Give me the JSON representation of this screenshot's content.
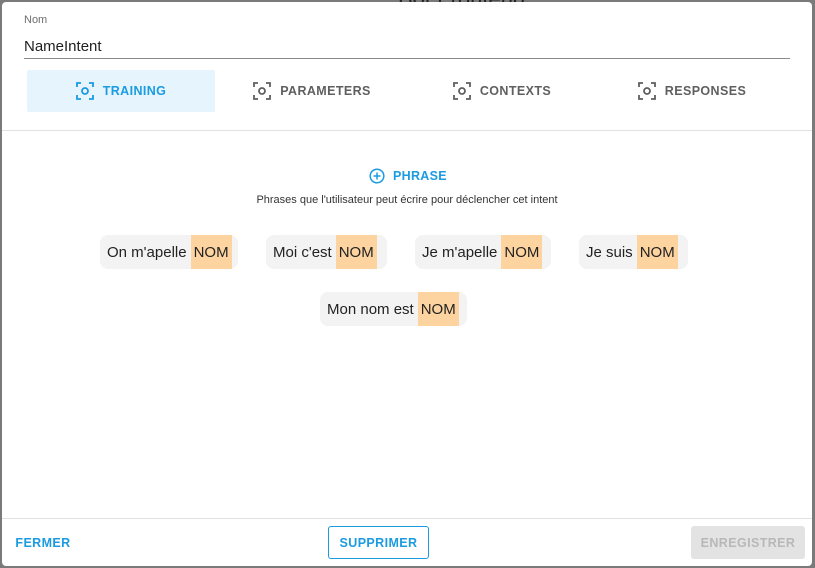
{
  "backdrop": {
    "title": "Bot Frontend"
  },
  "name_field": {
    "label": "Nom",
    "value": "NameIntent"
  },
  "tabs": [
    {
      "label": "TRAINING",
      "icon": "focus-frame-icon",
      "active": true
    },
    {
      "label": "PARAMETERS",
      "icon": "focus-frame-icon",
      "active": false
    },
    {
      "label": "CONTEXTS",
      "icon": "focus-frame-icon",
      "active": false
    },
    {
      "label": "RESPONSES",
      "icon": "focus-frame-icon",
      "active": false
    }
  ],
  "training": {
    "add_phrase_label": "PHRASE",
    "add_phrase_icon": "plus-circle-icon",
    "helper_text": "Phrases que l'utilisateur peut écrire pour déclencher cet intent",
    "phrases": [
      {
        "text": "On m'apelle",
        "entity": "NOM"
      },
      {
        "text": "Moi c'est",
        "entity": "NOM"
      },
      {
        "text": "Je m'apelle",
        "entity": "NOM"
      },
      {
        "text": "Je suis",
        "entity": "NOM"
      },
      {
        "text": "Mon nom est",
        "entity": "NOM"
      }
    ]
  },
  "footer": {
    "close_label": "FERMER",
    "delete_label": "SUPPRIMER",
    "save_label": "ENREGISTRER"
  },
  "colors": {
    "accent": "#1b9be0",
    "active_tab_bg": "#e6f4fd",
    "entity_highlight": "#fdd4a0",
    "chip_bg": "#f3f3f3",
    "disabled_bg": "#e3e3e3"
  }
}
